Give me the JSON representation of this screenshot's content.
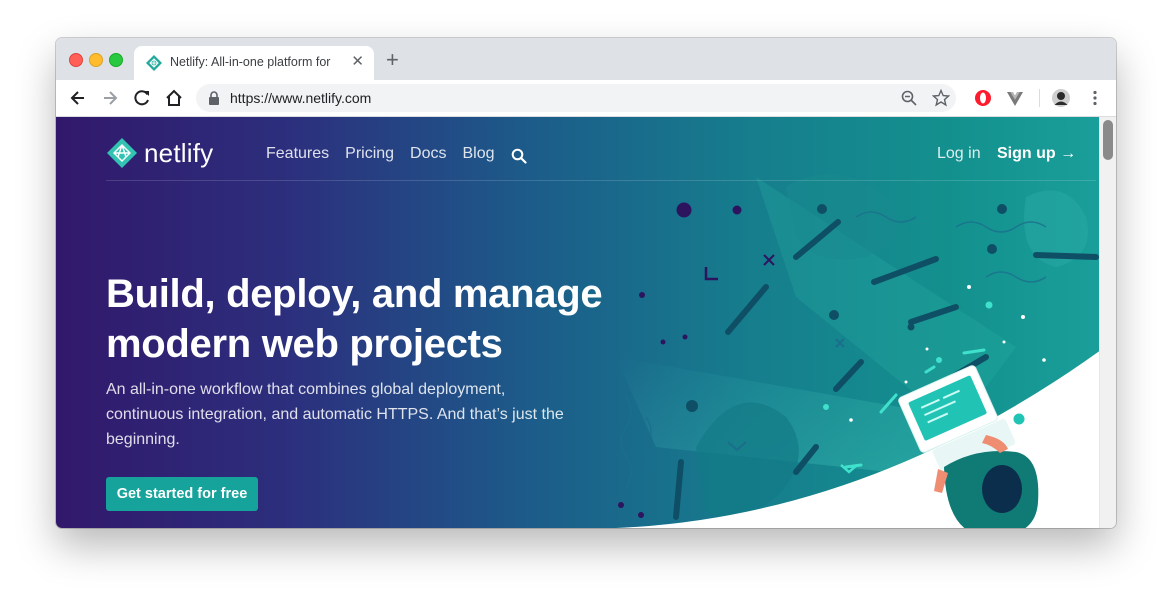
{
  "browser": {
    "tab_title": "Netlify: All-in-one platform for",
    "tab_close": "✕",
    "new_tab": "+",
    "url": "https://www.netlify.com"
  },
  "site": {
    "brand": "netlify",
    "nav": [
      "Features",
      "Pricing",
      "Docs",
      "Blog"
    ],
    "login": "Log in",
    "signup": "Sign up →",
    "headline_line1": "Build, deploy, and manage",
    "headline_line2": "modern web projects",
    "subtitle": "An all-in-one workflow that combines global deployment, continuous integration, and automatic HTTPS. And that’s just the beginning.",
    "cta": "Get started for free"
  },
  "colors": {
    "accent": "#15a39b",
    "gradient_start": "#32186b",
    "gradient_end": "#1ba09b"
  }
}
